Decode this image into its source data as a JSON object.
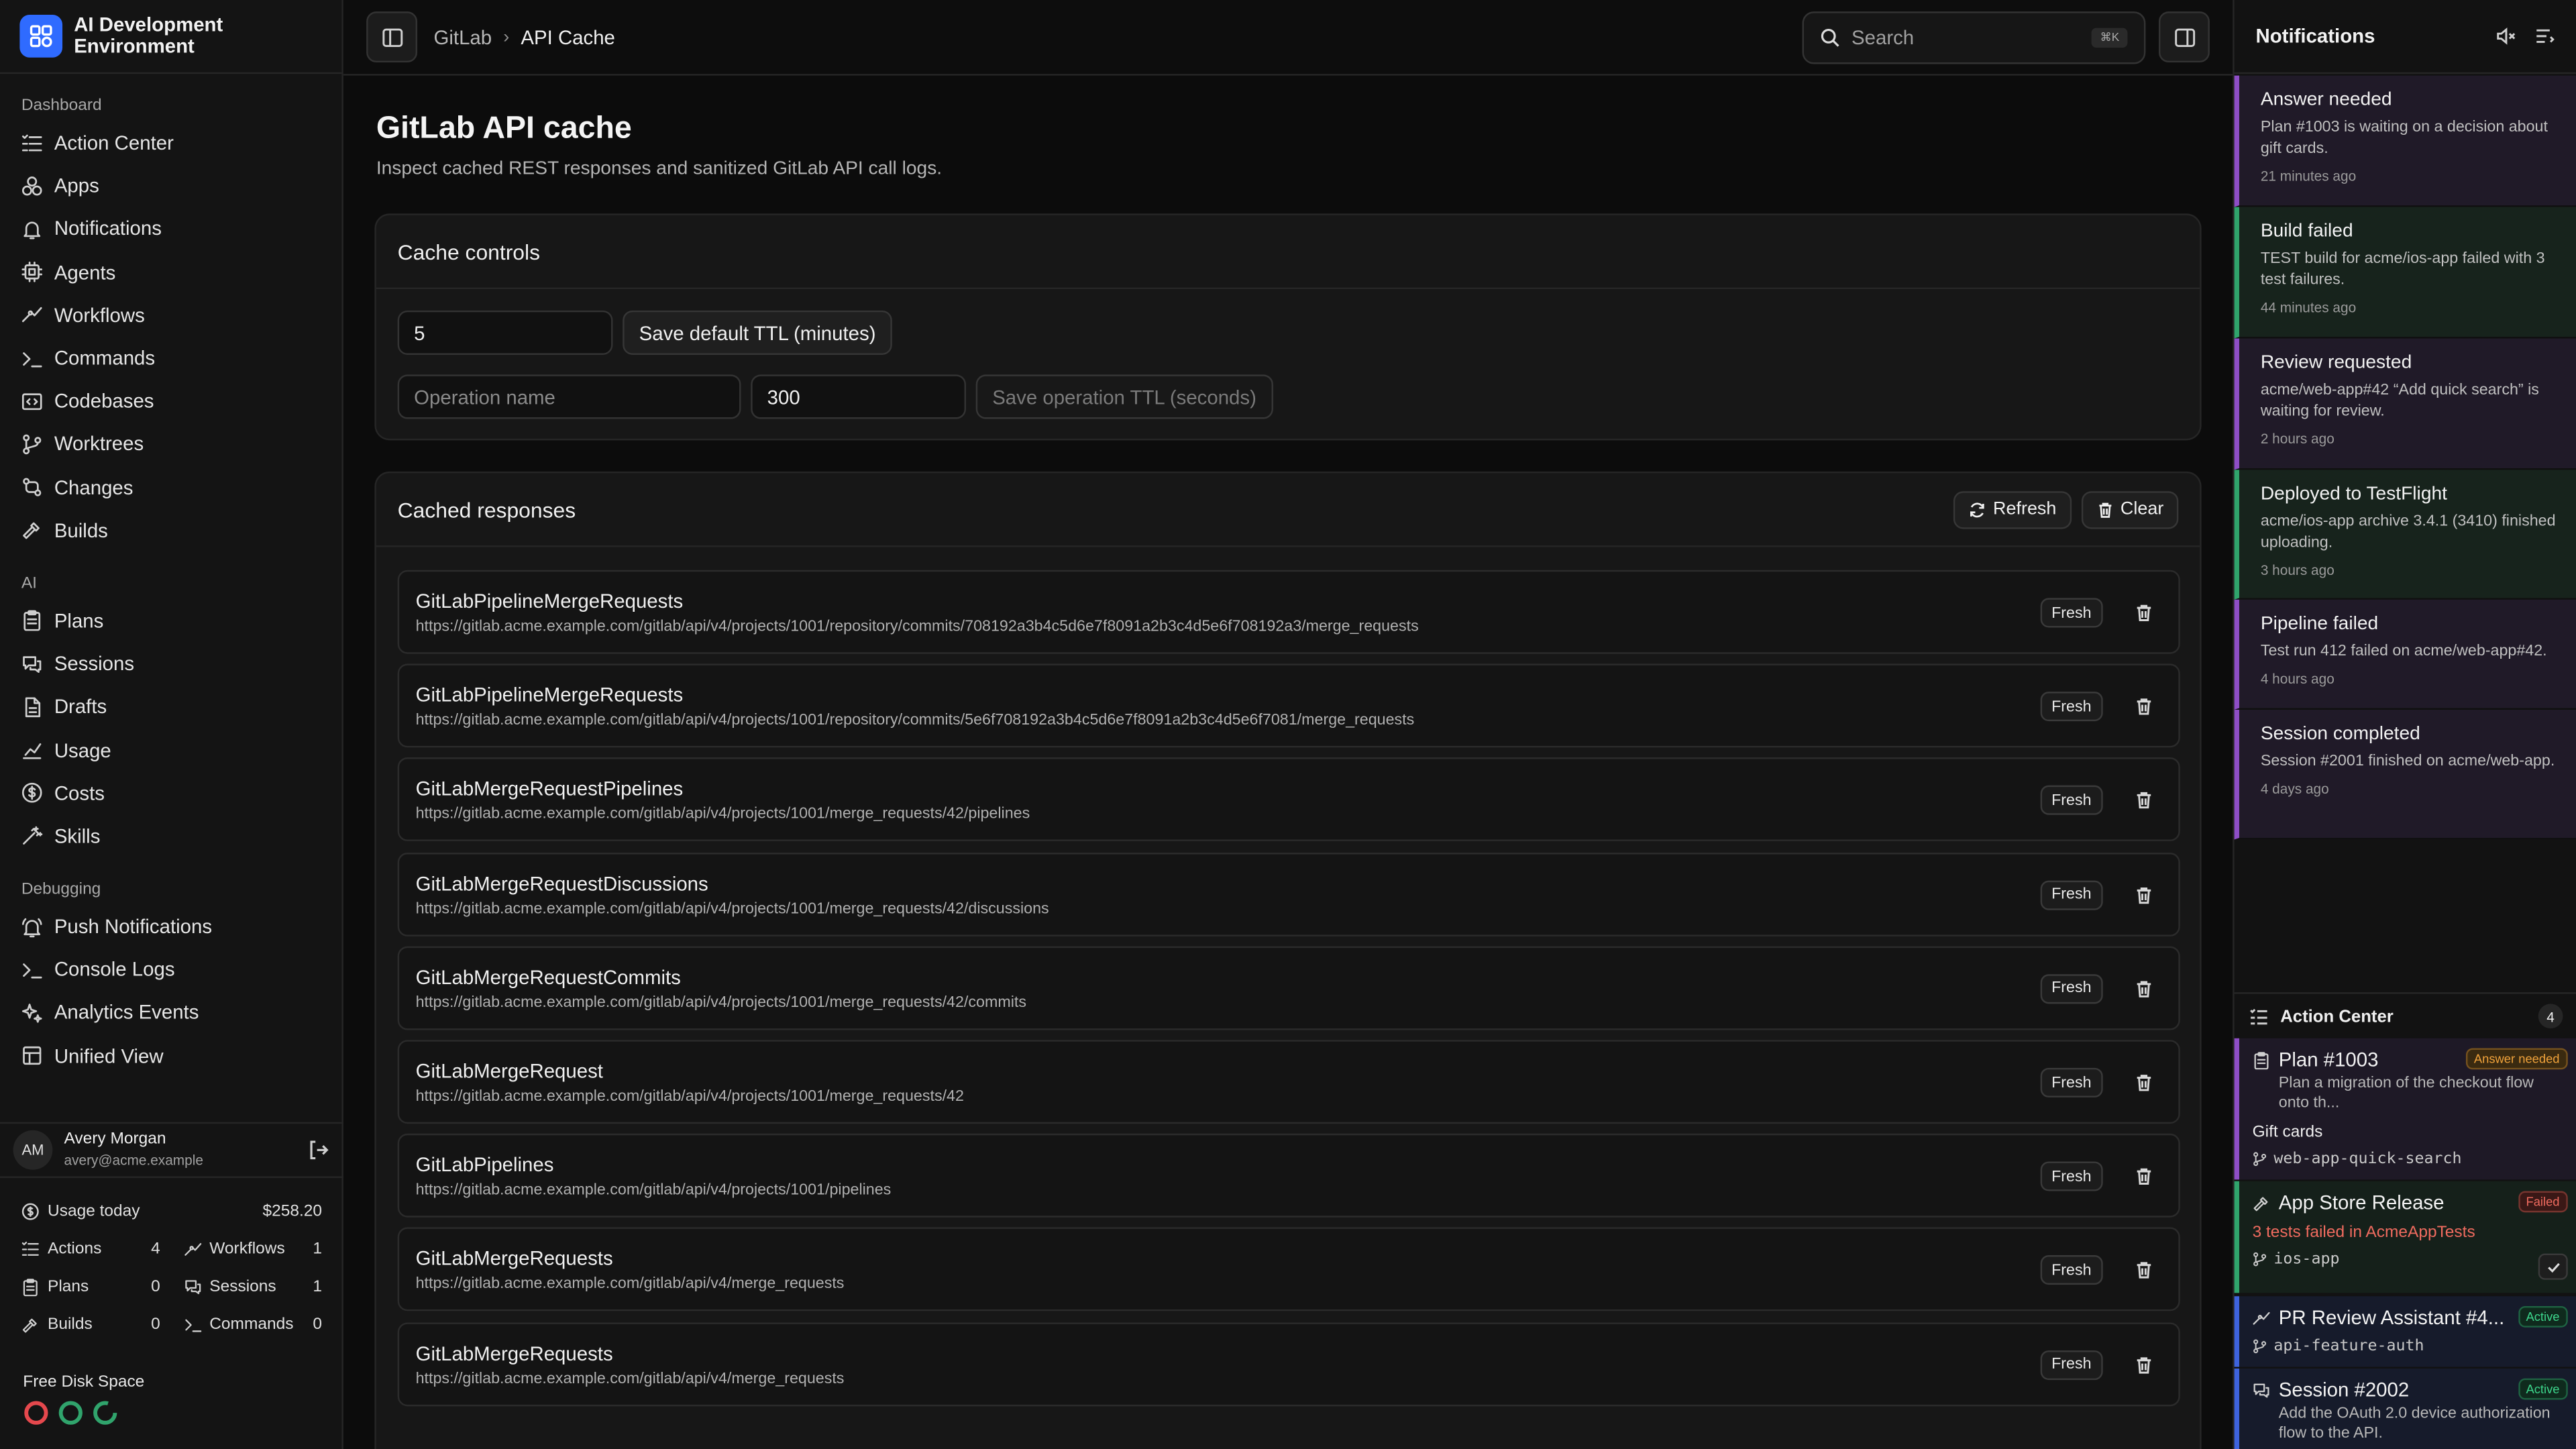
{
  "app": {
    "title": "AI Development Environment"
  },
  "sidebar": {
    "sections": [
      {
        "label": "Dashboard",
        "items": [
          {
            "label": "Action Center",
            "icon": "list-check-icon"
          },
          {
            "label": "Apps",
            "icon": "apps-icon"
          },
          {
            "label": "Notifications",
            "icon": "bell-icon"
          },
          {
            "label": "Agents",
            "icon": "cpu-icon"
          },
          {
            "label": "Workflows",
            "icon": "workflow-icon"
          },
          {
            "label": "Commands",
            "icon": "terminal-icon"
          },
          {
            "label": "Codebases",
            "icon": "codebase-icon"
          },
          {
            "label": "Worktrees",
            "icon": "branch-icon"
          },
          {
            "label": "Changes",
            "icon": "git-compare-icon"
          },
          {
            "label": "Builds",
            "icon": "hammer-icon"
          }
        ]
      },
      {
        "label": "AI",
        "items": [
          {
            "label": "Plans",
            "icon": "clipboard-icon"
          },
          {
            "label": "Sessions",
            "icon": "chat-icon"
          },
          {
            "label": "Drafts",
            "icon": "file-icon"
          },
          {
            "label": "Usage",
            "icon": "chart-icon"
          },
          {
            "label": "Costs",
            "icon": "dollar-icon"
          },
          {
            "label": "Skills",
            "icon": "wand-icon"
          }
        ]
      },
      {
        "label": "Debugging",
        "items": [
          {
            "label": "Push Notifications",
            "icon": "bell-ring-icon"
          },
          {
            "label": "Console Logs",
            "icon": "terminal-icon"
          },
          {
            "label": "Analytics Events",
            "icon": "sparkles-icon"
          },
          {
            "label": "Unified View",
            "icon": "layout-icon"
          }
        ]
      }
    ],
    "user": {
      "initials": "AM",
      "name": "Avery Morgan",
      "email": "avery@acme.example"
    },
    "usage": {
      "label": "Usage today",
      "amount": "$258.20",
      "stats": [
        {
          "label": "Actions",
          "value": "4",
          "icon": "list-check-icon"
        },
        {
          "label": "Workflows",
          "value": "1",
          "icon": "workflow-icon"
        },
        {
          "label": "Plans",
          "value": "0",
          "icon": "clipboard-icon"
        },
        {
          "label": "Sessions",
          "value": "1",
          "icon": "chat-icon"
        },
        {
          "label": "Builds",
          "value": "0",
          "icon": "hammer-icon"
        },
        {
          "label": "Commands",
          "value": "0",
          "icon": "terminal-icon"
        }
      ]
    },
    "disk": {
      "label": "Free Disk Space",
      "colors": [
        "#e5484d",
        "#30a46c",
        "#30a46c"
      ]
    }
  },
  "topbar": {
    "breadcrumb": [
      "GitLab",
      "API Cache"
    ],
    "search_placeholder": "Search",
    "search_shortcut": "⌘K"
  },
  "main": {
    "title": "GitLab API cache",
    "subtitle": "Inspect cached REST responses and sanitized GitLab API call logs.",
    "controls": {
      "title": "Cache controls",
      "default_ttl_value": "5",
      "default_ttl_button": "Save default TTL (minutes)",
      "operation_placeholder": "Operation name",
      "operation_ttl_value": "300",
      "operation_ttl_button": "Save operation TTL (seconds)"
    },
    "cached": {
      "title": "Cached responses",
      "refresh_label": "Refresh",
      "clear_label": "Clear",
      "rows": [
        {
          "name": "GitLabPipelineMergeRequests",
          "url": "https://gitlab.acme.example.com/gitlab/api/v4/projects/1001/repository/commits/708192a3b4c5d6e7f8091a2b3c4d5e6f708192a3/merge_requests",
          "status": "Fresh"
        },
        {
          "name": "GitLabPipelineMergeRequests",
          "url": "https://gitlab.acme.example.com/gitlab/api/v4/projects/1001/repository/commits/5e6f708192a3b4c5d6e7f8091a2b3c4d5e6f7081/merge_requests",
          "status": "Fresh"
        },
        {
          "name": "GitLabMergeRequestPipelines",
          "url": "https://gitlab.acme.example.com/gitlab/api/v4/projects/1001/merge_requests/42/pipelines",
          "status": "Fresh"
        },
        {
          "name": "GitLabMergeRequestDiscussions",
          "url": "https://gitlab.acme.example.com/gitlab/api/v4/projects/1001/merge_requests/42/discussions",
          "status": "Fresh"
        },
        {
          "name": "GitLabMergeRequestCommits",
          "url": "https://gitlab.acme.example.com/gitlab/api/v4/projects/1001/merge_requests/42/commits",
          "status": "Fresh"
        },
        {
          "name": "GitLabMergeRequest",
          "url": "https://gitlab.acme.example.com/gitlab/api/v4/projects/1001/merge_requests/42",
          "status": "Fresh"
        },
        {
          "name": "GitLabPipelines",
          "url": "https://gitlab.acme.example.com/gitlab/api/v4/projects/1001/pipelines",
          "status": "Fresh"
        },
        {
          "name": "GitLabMergeRequests",
          "url": "https://gitlab.acme.example.com/gitlab/api/v4/merge_requests",
          "status": "Fresh"
        },
        {
          "name": "GitLabMergeRequests",
          "url": "https://gitlab.acme.example.com/gitlab/api/v4/merge_requests",
          "status": "Fresh"
        }
      ]
    }
  },
  "notifications": {
    "title": "Notifications",
    "items": [
      {
        "title": "Answer needed",
        "body": "Plan #1003 is waiting on a decision about gift cards.",
        "time": "21 minutes ago",
        "accent": "#8e4ec6",
        "bg": "#201a28"
      },
      {
        "title": "Build failed",
        "body": "TEST build for acme/ios-app failed with 3 test failures.",
        "time": "44 minutes ago",
        "accent": "#30a46c",
        "bg": "#17231c"
      },
      {
        "title": "Review requested",
        "body": "acme/web-app#42 “Add quick search” is waiting for review.",
        "time": "2 hours ago",
        "accent": "#8e4ec6",
        "bg": "#201a28"
      },
      {
        "title": "Deployed to TestFlight",
        "body": "acme/ios-app archive 3.4.1 (3410) finished uploading.",
        "time": "3 hours ago",
        "accent": "#30a46c",
        "bg": "#17231c"
      },
      {
        "title": "Pipeline failed",
        "body": "Test run 412 failed on acme/web-app#42.",
        "time": "4 hours ago",
        "accent": "#8e4ec6",
        "bg": "#201a28"
      },
      {
        "title": "Session completed",
        "body": "Session #2001 finished on acme/web-app.",
        "time": "4 days ago",
        "accent": "#8e4ec6",
        "bg": "#201a28"
      }
    ]
  },
  "action_center": {
    "title": "Action Center",
    "count": "4",
    "items": [
      {
        "title": "Plan #1003",
        "tag": "Answer needed",
        "desc": "Plan a migration of the checkout flow onto th...",
        "sub": "Gift cards",
        "branch": "web-app-quick-search"
      },
      {
        "title": "App Store Release",
        "tag": "Failed",
        "error": "3 tests failed in AcmeAppTests",
        "branch": "ios-app"
      },
      {
        "title": "PR Review Assistant #4...",
        "tag": "Active",
        "branch": "api-feature-auth"
      },
      {
        "title": "Session #2002",
        "tag": "Active",
        "desc": "Add the OAuth 2.0 device authorization flow to the API."
      }
    ]
  }
}
